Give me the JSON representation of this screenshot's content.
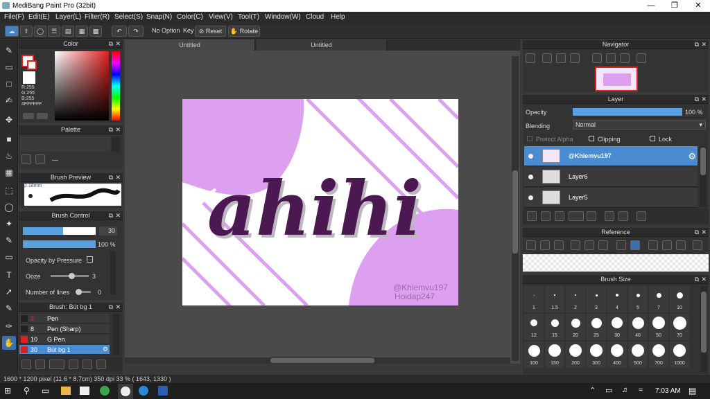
{
  "window": {
    "title": "MediBang Paint Pro (32bit)"
  },
  "menu": [
    "File(F)",
    "Edit(E)",
    "Layer(L)",
    "Filter(R)",
    "Select(S)",
    "Snap(N)",
    "Color(C)",
    "View(V)",
    "Tool(T)",
    "Window(W)",
    "Cloud",
    "Help"
  ],
  "toolbar": {
    "no_option": "No Option",
    "key": "Key",
    "reset": "Reset",
    "rotate": "Rotate"
  },
  "tabs": [
    "Untitled",
    "Untitled"
  ],
  "color_panel": {
    "title": "Color",
    "r": "R:255",
    "g": "G:255",
    "b": "B:255",
    "hex": "#FFFFFF"
  },
  "palette_panel": {
    "title": "Palette",
    "text": "---"
  },
  "brush_preview": {
    "title": "Brush Preview",
    "size": "2.18mm"
  },
  "brush_control": {
    "title": "Brush Control",
    "size_value": "30",
    "opacity_value": "100 %",
    "opacity_by_pressure": "Opacity by Pressure",
    "ooze_label": "Ooze",
    "ooze_value": "3",
    "lines_label": "Number of lines",
    "lines_value": "0"
  },
  "brush_list": {
    "title": "Brush: Bút bg 1",
    "items": [
      {
        "num": "2",
        "name": "Pen",
        "color": "#222222"
      },
      {
        "num": "8",
        "name": "Pen (Sharp)",
        "color": "#222222"
      },
      {
        "num": "10",
        "name": "G Pen",
        "color": "#e02020"
      },
      {
        "num": "30",
        "name": "Bút bg 1",
        "color": "#e02020"
      }
    ]
  },
  "artwork": {
    "text": "ahihi",
    "credit1": "@Khiemvu197",
    "credit2": "Hoidap247"
  },
  "navigator": {
    "title": "Navigator"
  },
  "layer_panel": {
    "title": "Layer",
    "opacity_label": "Opacity",
    "opacity_value": "100 %",
    "blending_label": "Blending",
    "blending_value": "Normal",
    "protect_alpha": "Protect Alpha",
    "clipping": "Clipping",
    "lock": "Lock",
    "layers": [
      "@Khiemvu197",
      "Layer6",
      "Layer5"
    ]
  },
  "reference": {
    "title": "Reference"
  },
  "brush_size": {
    "title": "Brush Size",
    "sizes": [
      "1",
      "1.5",
      "2",
      "3",
      "4",
      "5",
      "7",
      "10",
      "12",
      "15",
      "20",
      "25",
      "30",
      "40",
      "50",
      "70",
      "100",
      "150",
      "200",
      "300",
      "400",
      "500",
      "700",
      "1000"
    ]
  },
  "status": {
    "text": "1600 * 1200 pixel  (11.6 * 8.7cm)  350 dpi  33 %  ( 1643, 1330 )"
  },
  "taskbar": {
    "time": "7:03 AM"
  }
}
